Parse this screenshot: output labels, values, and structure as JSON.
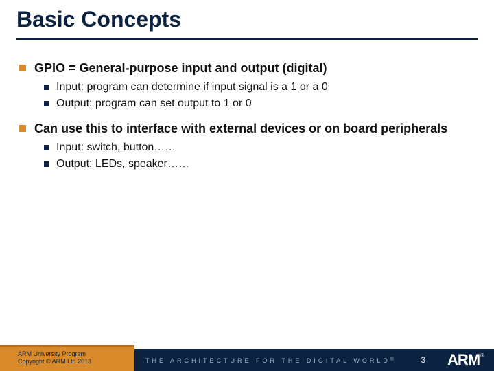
{
  "title": "Basic Concepts",
  "bullets": [
    {
      "text": "GPIO = General-purpose input and output (digital)",
      "sub": [
        "Input: program can determine if input signal is a 1 or a 0",
        "Output: program can set output to 1 or 0"
      ]
    },
    {
      "text": "Can use this to interface with external devices or on board peripherals",
      "sub": [
        "Input: switch, button……",
        "Output: LEDs, speaker……"
      ]
    }
  ],
  "footer": {
    "line1": "ARM University Program",
    "line2": "Copyright © ARM Ltd 2013",
    "tagline": "THE ARCHITECTURE FOR THE DIGITAL WORLD",
    "page": "3",
    "logo": "ARM"
  }
}
